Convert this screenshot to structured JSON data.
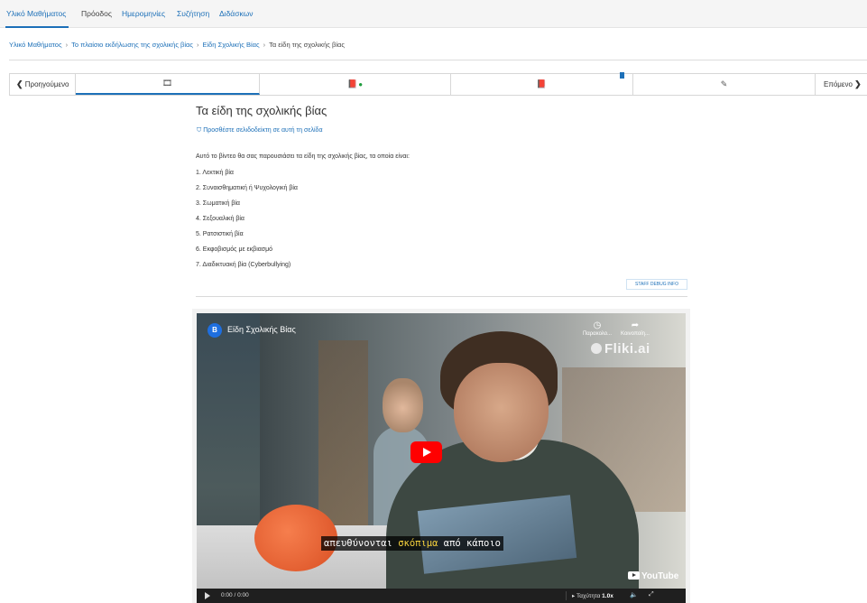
{
  "top_tabs": [
    {
      "label": "Υλικό Μαθήματος",
      "active": true
    },
    {
      "label": "Πρόοδος"
    },
    {
      "label": "Ημερομηνίες"
    },
    {
      "label": "Συζήτηση"
    },
    {
      "label": "Διδάσκων"
    }
  ],
  "breadcrumb": [
    "Υλικό Μαθήματος",
    "Το πλαίσιο εκδήλωσης της σχολικής βίας",
    "Είδη Σχολικής Βίας",
    "Τα είδη της σχολικής βίας"
  ],
  "sequence_nav": {
    "prev_label": "Προηγούμενο",
    "next_label": "Επόμενο",
    "units": [
      {
        "icon": "video-icon",
        "glyph": "🎞",
        "active": true
      },
      {
        "icon": "book-check-icon",
        "glyph": "📕",
        "completed": true
      },
      {
        "icon": "book-icon",
        "glyph": "📕"
      },
      {
        "icon": "edit-icon",
        "glyph": "✎"
      }
    ],
    "bookmarked_unit": 2
  },
  "unit": {
    "title": "Τα είδη της σχολικής βίας",
    "bookmark_label": "Προσθέστε σελιδοδείκτη σε αυτή τη σελίδα",
    "intro": "Αυτό το βίντεο θα σας παρουσιάσει τα είδη της σχολικής βίας, τα οποία είναι:",
    "types": [
      "1. Λεκτική βία",
      "2. Συναισθηματική ή Ψυχολογική βία",
      "3. Σωματική βία",
      "4. Σεξουαλική βία",
      "5. Ρατσιστική βία",
      "6. Εκφοβισμός με εκβιασμό",
      "7. Διαδικτυακή βία (Cyberbullying)"
    ],
    "debug_button": "STAFF DEBUG INFO"
  },
  "video": {
    "channel_initial": "Β",
    "title": "Είδη Σχολικής Βίας",
    "watch_later": "Παρακολο...",
    "share": "Κοινοποίη...",
    "watermark": "Fliki.ai",
    "subtitle_before": "απευθύνονται ",
    "subtitle_highlight": "σκόπιμα",
    "subtitle_after": " από κάποιο",
    "youtube_logo": "YouTube",
    "time": "0:00 / 0:00",
    "speed_label": "Ταχύτητα",
    "speed_value": "1.0x",
    "colors": {
      "play_button": "#ff0000",
      "subtitle_highlight": "#f7d33d",
      "link": "#1d70b8"
    }
  }
}
